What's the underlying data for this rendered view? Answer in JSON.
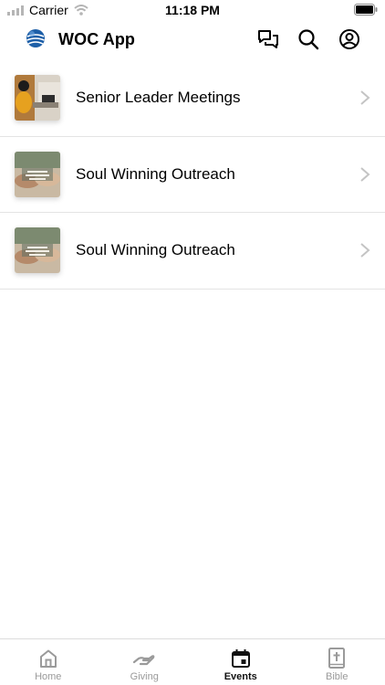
{
  "status_bar": {
    "carrier": "Carrier",
    "time": "11:18 PM"
  },
  "header": {
    "title": "WOC App",
    "icons": [
      "logo-globe-icon",
      "chat-icon",
      "search-icon",
      "profile-icon"
    ]
  },
  "events": [
    {
      "title": "Senior Leader Meetings",
      "thumbnail": "meeting-photo"
    },
    {
      "title": "Soul Winning Outreach",
      "thumbnail": "hands-photo"
    },
    {
      "title": "Soul Winning Outreach",
      "thumbnail": "hands-photo"
    }
  ],
  "tabs": [
    {
      "label": "Home",
      "icon": "home-icon",
      "active": false
    },
    {
      "label": "Giving",
      "icon": "giving-hand-icon",
      "active": false
    },
    {
      "label": "Events",
      "icon": "calendar-icon",
      "active": true
    },
    {
      "label": "Bible",
      "icon": "bible-icon",
      "active": false
    }
  ],
  "colors": {
    "active_tab": "#111111",
    "inactive_tab": "#9a9a9a",
    "divider": "#e4e4e4",
    "logo_blue": "#1d5fa8"
  }
}
